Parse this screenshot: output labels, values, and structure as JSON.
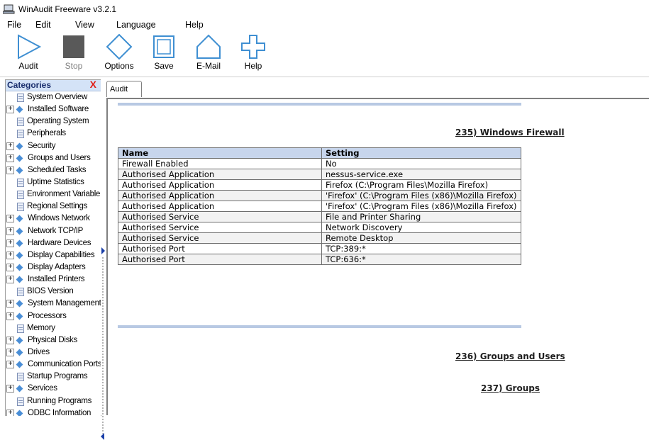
{
  "window": {
    "title": "WinAudit Freeware v3.2.1"
  },
  "menu": {
    "file": "File",
    "edit": "Edit",
    "view": "View",
    "language": "Language",
    "help": "Help"
  },
  "toolbar": {
    "audit": "Audit",
    "stop": "Stop",
    "options": "Options",
    "save": "Save",
    "email": "E-Mail",
    "help": "Help"
  },
  "sidebar": {
    "header": "Categories",
    "close_glyph": "X",
    "items": [
      {
        "label": "System Overview",
        "expandable": false
      },
      {
        "label": "Installed Software",
        "expandable": true
      },
      {
        "label": "Operating System",
        "expandable": false
      },
      {
        "label": "Peripherals",
        "expandable": false
      },
      {
        "label": "Security",
        "expandable": true
      },
      {
        "label": "Groups and Users",
        "expandable": true
      },
      {
        "label": "Scheduled Tasks",
        "expandable": true
      },
      {
        "label": "Uptime Statistics",
        "expandable": false
      },
      {
        "label": "Environment Variable",
        "expandable": false
      },
      {
        "label": "Regional Settings",
        "expandable": false
      },
      {
        "label": "Windows Network",
        "expandable": true
      },
      {
        "label": "Network TCP/IP",
        "expandable": true
      },
      {
        "label": "Hardware Devices",
        "expandable": true
      },
      {
        "label": "Display Capabilities",
        "expandable": true
      },
      {
        "label": "Display Adapters",
        "expandable": true
      },
      {
        "label": "Installed Printers",
        "expandable": true
      },
      {
        "label": "BIOS Version",
        "expandable": false
      },
      {
        "label": "System Management",
        "expandable": true
      },
      {
        "label": "Processors",
        "expandable": true
      },
      {
        "label": "Memory",
        "expandable": false
      },
      {
        "label": "Physical Disks",
        "expandable": true
      },
      {
        "label": "Drives",
        "expandable": true
      },
      {
        "label": "Communication Ports",
        "expandable": true
      },
      {
        "label": "Startup Programs",
        "expandable": false
      },
      {
        "label": "Services",
        "expandable": true
      },
      {
        "label": "Running Programs",
        "expandable": false
      },
      {
        "label": "ODBC Information",
        "expandable": true
      }
    ]
  },
  "tabs": {
    "audit": "Audit"
  },
  "report": {
    "section_235": "235) Windows Firewall",
    "section_236": "236) Groups and Users",
    "section_237": "237) Groups",
    "table": {
      "headers": [
        "Name",
        "Setting"
      ],
      "rows": [
        [
          "Firewall Enabled",
          "No"
        ],
        [
          "Authorised Application",
          "nessus-service.exe"
        ],
        [
          "Authorised Application",
          "Firefox (C:\\Program Files\\Mozilla Firefox)"
        ],
        [
          "Authorised Application",
          "'Firefox' (C:\\Program Files (x86)\\Mozilla Firefox)"
        ],
        [
          "Authorised Application",
          "'Firefox' (C:\\Program Files (x86)\\Mozilla Firefox)"
        ],
        [
          "Authorised Service",
          "File and Printer Sharing"
        ],
        [
          "Authorised Service",
          "Network Discovery"
        ],
        [
          "Authorised Service",
          "Remote Desktop"
        ],
        [
          "Authorised Port",
          "TCP:389:*"
        ],
        [
          "Authorised Port",
          "TCP:636:*"
        ]
      ]
    }
  },
  "colors": {
    "toolbar_icon": "#3f8fd2",
    "stop_icon": "#595959",
    "header_bg": "#c7d5ec",
    "close_red": "#e0201a"
  }
}
